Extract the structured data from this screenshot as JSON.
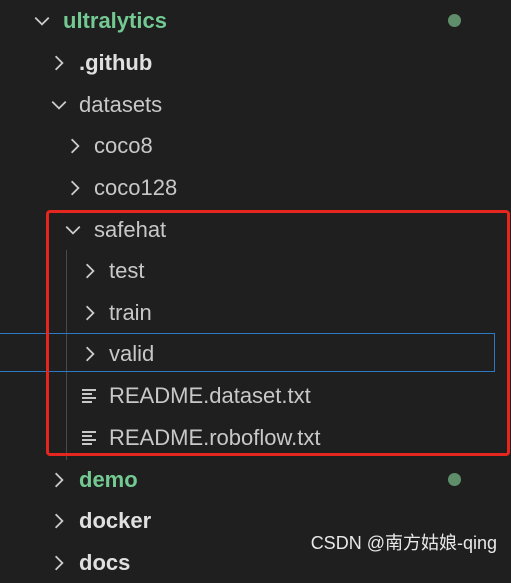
{
  "tree": {
    "root": {
      "label": "ultralytics",
      "expanded": true,
      "modified": true
    },
    "items": [
      {
        "label": ".github",
        "expanded": false
      },
      {
        "label": "datasets",
        "expanded": true
      },
      {
        "label": "coco8",
        "expanded": false
      },
      {
        "label": "coco128",
        "expanded": false
      },
      {
        "label": "safehat",
        "expanded": true
      },
      {
        "label": "test",
        "expanded": false
      },
      {
        "label": "train",
        "expanded": false
      },
      {
        "label": "valid",
        "expanded": false,
        "selected": true
      },
      {
        "label": "README.dataset.txt",
        "type": "file"
      },
      {
        "label": "README.roboflow.txt",
        "type": "file"
      },
      {
        "label": "demo",
        "expanded": false,
        "modified": true
      },
      {
        "label": "docker",
        "expanded": false
      },
      {
        "label": "docs",
        "expanded": false
      }
    ]
  },
  "colors": {
    "background": "#1f1f1f",
    "modified_text": "#73c991",
    "highlight_box": "#e5261e",
    "selection_border": "#2b79c2"
  },
  "watermark": "CSDN @南方姑娘-qing"
}
